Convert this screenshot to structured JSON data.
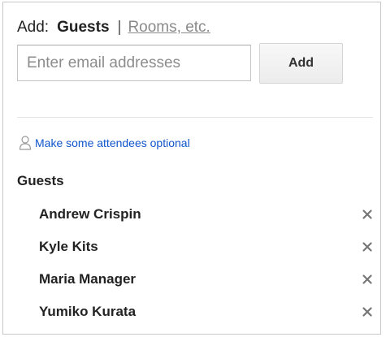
{
  "header": {
    "add_prefix": "Add:",
    "tab_guests": "Guests",
    "separator": "|",
    "tab_rooms": "Rooms, etc."
  },
  "input": {
    "placeholder": "Enter email addresses",
    "value": ""
  },
  "add_button": {
    "label": "Add"
  },
  "optional": {
    "icon": "person-outline-icon",
    "label": "Make some attendees optional"
  },
  "guests": {
    "heading": "Guests",
    "items": [
      {
        "name": "Andrew Crispin"
      },
      {
        "name": "Kyle Kits"
      },
      {
        "name": "Maria Manager"
      },
      {
        "name": "Yumiko Kurata"
      }
    ],
    "remove_icon": "close-icon"
  },
  "colors": {
    "link": "#1155cc",
    "inactive_tab": "#8a8a8a",
    "border": "#c8c8c8",
    "remove_icon": "#777777"
  }
}
